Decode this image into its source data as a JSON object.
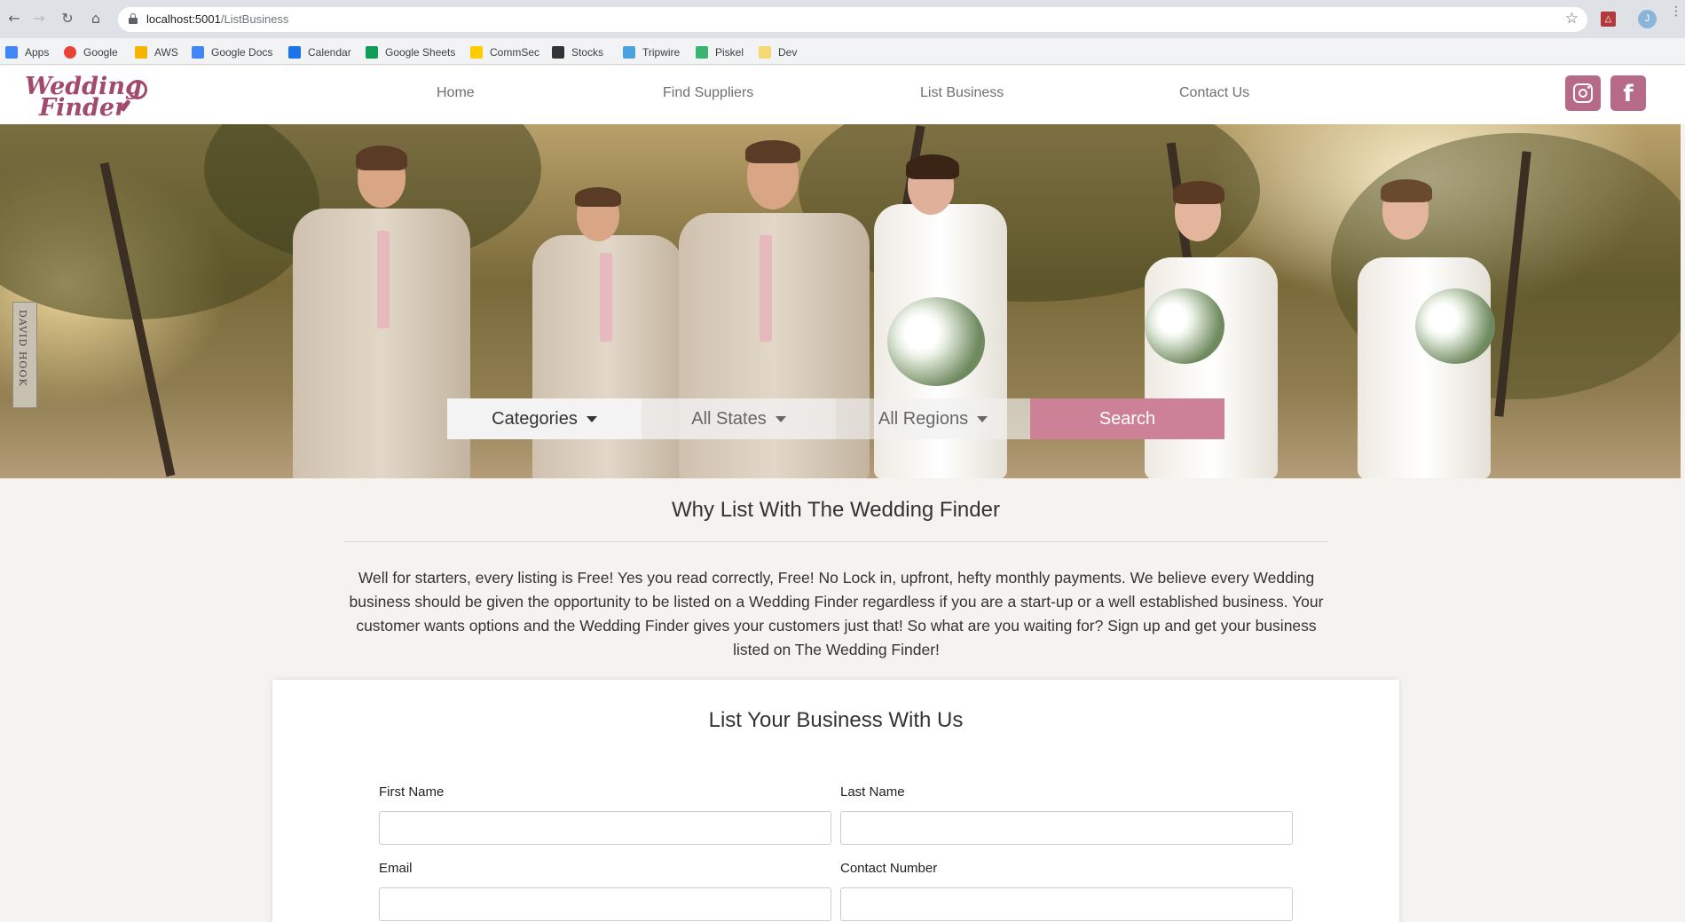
{
  "browser": {
    "url_host": "localhost:5001",
    "url_path": "/ListBusiness",
    "profile_initial": "J",
    "bookmarks": [
      {
        "label": "Apps",
        "color": "#4285f4"
      },
      {
        "label": "Google",
        "color": "#ea4335"
      },
      {
        "label": "AWS",
        "color": "#f5b400"
      },
      {
        "label": "Google Docs",
        "color": "#4285f4"
      },
      {
        "label": "Calendar",
        "color": "#1a73e8"
      },
      {
        "label": "Google Sheets",
        "color": "#0f9d58"
      },
      {
        "label": "CommSec",
        "color": "#ffcc00"
      },
      {
        "label": "Stocks",
        "color": "#333333"
      },
      {
        "label": "Tripwire",
        "color": "#4aa3df"
      },
      {
        "label": "Piskel",
        "color": "#3cb371"
      },
      {
        "label": "Dev",
        "color": "#f7d774"
      }
    ]
  },
  "site": {
    "logo_line1": "Wedding",
    "logo_line2": "Finder",
    "nav": [
      "Home",
      "Find Suppliers",
      "List Business",
      "Contact Us"
    ],
    "brand_color": "#b66a86"
  },
  "hero": {
    "watermark": "DAVID HOOK",
    "search": {
      "categories": "Categories",
      "states": "All States",
      "regions": "All Regions",
      "button": "Search"
    }
  },
  "why": {
    "title": "Why List With The Wedding Finder",
    "body": "Well for starters, every listing is Free! Yes you read correctly, Free! No Lock in, upfront, hefty monthly payments. We believe every Wedding business should be given the opportunity to be listed on a Wedding Finder regardless if you are a start-up or a well established business. Your customer wants options and the Wedding Finder gives your customers just that! So what are you waiting for? Sign up and get your business listed on The Wedding Finder!"
  },
  "form": {
    "title": "List Your Business With Us",
    "first_name_label": "First Name",
    "last_name_label": "Last Name",
    "email_label": "Email",
    "contact_label": "Contact Number",
    "first_name_value": "",
    "last_name_value": "",
    "email_value": "",
    "contact_value": ""
  }
}
